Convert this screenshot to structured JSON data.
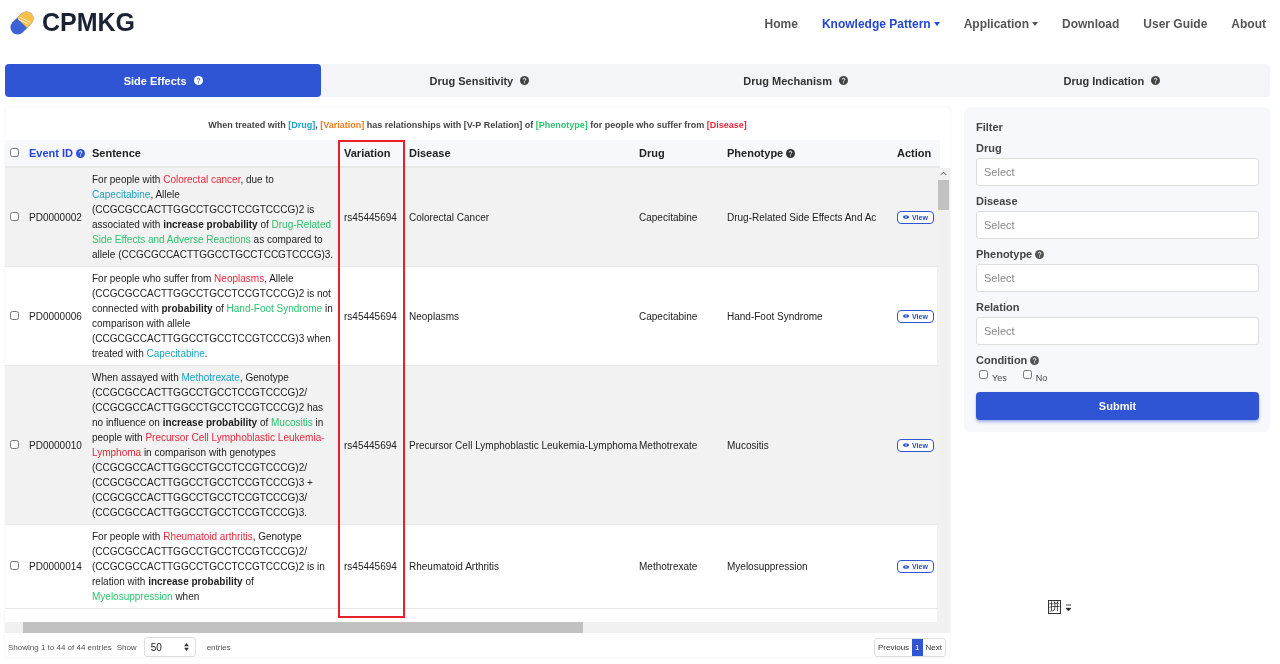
{
  "brand": {
    "name": "CPMKG"
  },
  "nav": [
    {
      "label": "Home",
      "selected": false,
      "dropdown": false
    },
    {
      "label": "Knowledge Pattern",
      "selected": true,
      "dropdown": true
    },
    {
      "label": "Application",
      "selected": false,
      "dropdown": true
    },
    {
      "label": "Download",
      "selected": false,
      "dropdown": false
    },
    {
      "label": "User Guide",
      "selected": false,
      "dropdown": false
    },
    {
      "label": "About",
      "selected": false,
      "dropdown": false
    }
  ],
  "tabs": [
    {
      "label": "Side Effects",
      "selected": true
    },
    {
      "label": "Drug Sensitivity",
      "selected": false
    },
    {
      "label": "Drug Mechanism",
      "selected": false
    },
    {
      "label": "Drug Indication",
      "selected": false
    }
  ],
  "pattern": [
    {
      "text": "When treated with ",
      "kind": "text"
    },
    {
      "text": "[Drug]",
      "kind": "drug"
    },
    {
      "text": ", ",
      "kind": "text"
    },
    {
      "text": "[Variation]",
      "kind": "variation"
    },
    {
      "text": " has relationships with [V-P Relation] of ",
      "kind": "text"
    },
    {
      "text": "[Phenotype]",
      "kind": "phenotype"
    },
    {
      "text": " for people who suffer from ",
      "kind": "text"
    },
    {
      "text": "[Disease]",
      "kind": "disease"
    }
  ],
  "table": {
    "select_all_checked": false,
    "columns": [
      {
        "label": "Event ID",
        "help": true,
        "link": true
      },
      {
        "label": "Sentence",
        "help": false,
        "link": false
      },
      {
        "label": "Variation",
        "help": false,
        "link": false
      },
      {
        "label": "Disease",
        "help": false,
        "link": false
      },
      {
        "label": "Drug",
        "help": false,
        "link": false
      },
      {
        "label": "Phenotype",
        "help": true,
        "link": false
      },
      {
        "label": "Action",
        "help": false,
        "link": false
      }
    ],
    "rows": [
      {
        "checked": false,
        "id": "PD0000002",
        "sentence": [
          {
            "text": "For people with ",
            "kind": "text"
          },
          {
            "text": "Colorectal cancer",
            "kind": "disease"
          },
          {
            "text": ", due to ",
            "kind": "text"
          },
          {
            "text": "Capecitabine",
            "kind": "drug"
          },
          {
            "text": ", Allele (CCGCGCCACTTGGCCTGCCTCCGTCCCG)2 is associated with ",
            "kind": "text"
          },
          {
            "text": "increase probability",
            "kind": "bold"
          },
          {
            "text": " of ",
            "kind": "text"
          },
          {
            "text": "Drug-Related Side Effects and Adverse Reactions",
            "kind": "phenotype"
          },
          {
            "text": " as compared to allele (CCGCGCCACTTGGCCTGCCTCCGTCCCG)3.",
            "kind": "text"
          }
        ],
        "variation": "rs45445694",
        "disease": "Colorectal Cancer",
        "drug": "Capecitabine",
        "phenotype": "Drug-Related Side Effects And Ac",
        "action": "View"
      },
      {
        "checked": false,
        "id": "PD0000006",
        "sentence": [
          {
            "text": "For people who suffer from ",
            "kind": "text"
          },
          {
            "text": "Neoplasms",
            "kind": "disease"
          },
          {
            "text": ", Allele (CCGCGCCACTTGGCCTGCCTCCGTCCCG)2 is not connected with ",
            "kind": "text"
          },
          {
            "text": "probability",
            "kind": "bold"
          },
          {
            "text": " of ",
            "kind": "text"
          },
          {
            "text": "Hand-Foot Syndrome",
            "kind": "phenotype"
          },
          {
            "text": " in comparison with allele (CCGCGCCACTTGGCCTGCCTCCGTCCCG)3 when treated with ",
            "kind": "text"
          },
          {
            "text": "Capecitabine",
            "kind": "drug"
          },
          {
            "text": ".",
            "kind": "text"
          }
        ],
        "variation": "rs45445694",
        "disease": "Neoplasms",
        "drug": "Capecitabine",
        "phenotype": "Hand-Foot Syndrome",
        "action": "View"
      },
      {
        "checked": false,
        "id": "PD0000010",
        "sentence": [
          {
            "text": "When assayed with ",
            "kind": "text"
          },
          {
            "text": "Methotrexate",
            "kind": "drug"
          },
          {
            "text": ", Genotype (CCGCGCCACTTGGCCTGCCTCCGTCCCG)2/ (CCGCGCCACTTGGCCTGCCTCCGTCCCG)2 has no influence on ",
            "kind": "text"
          },
          {
            "text": "increase probability",
            "kind": "bold"
          },
          {
            "text": " of ",
            "kind": "text"
          },
          {
            "text": "Mucositis",
            "kind": "phenotype"
          },
          {
            "text": " in people with ",
            "kind": "text"
          },
          {
            "text": "Precursor Cell Lymphoblastic Leukemia-Lymphoma",
            "kind": "disease"
          },
          {
            "text": " in comparison with genotypes (CCGCGCCACTTGGCCTGCCTCCGTCCCG)2/ (CCGCGCCACTTGGCCTGCCTCCGTCCCG)3 + (CCGCGCCACTTGGCCTGCCTCCGTCCCG)3/ (CCGCGCCACTTGGCCTGCCTCCGTCCCG)3.",
            "kind": "text"
          }
        ],
        "variation": "rs45445694",
        "disease": "Precursor Cell Lymphoblastic Leukemia-Lymphoma",
        "drug": "Methotrexate",
        "phenotype": "Mucositis",
        "action": "View"
      },
      {
        "checked": false,
        "id": "PD0000014",
        "sentence": [
          {
            "text": "For people with ",
            "kind": "text"
          },
          {
            "text": "Rheumatoid arthritis",
            "kind": "disease"
          },
          {
            "text": ", Genotype (CCGCGCCACTTGGCCTGCCTCCGTCCCG)2/ (CCGCGCCACTTGGCCTGCCTCCGTCCCG)2 is in relation with ",
            "kind": "text"
          },
          {
            "text": "increase probability",
            "kind": "bold"
          },
          {
            "text": " of ",
            "kind": "text"
          },
          {
            "text": "Myelosuppression",
            "kind": "phenotype"
          },
          {
            "text": " when",
            "kind": "text"
          }
        ],
        "variation": "rs45445694",
        "disease": "Rheumatoid Arthritis",
        "drug": "Methotrexate",
        "phenotype": "Myelosuppression",
        "action": "View"
      }
    ]
  },
  "footer": {
    "info": "Showing 1 to 44 of 44 entries",
    "show_label": "Show",
    "page_size": "50",
    "entries_label": "entries",
    "pages": [
      {
        "label": "Previous",
        "selected": false
      },
      {
        "label": "1",
        "selected": true
      },
      {
        "label": "Next",
        "selected": false
      }
    ]
  },
  "filter": {
    "title": "Filter",
    "fields": [
      {
        "label": "Drug",
        "help": false,
        "placeholder": "Select"
      },
      {
        "label": "Disease",
        "help": false,
        "placeholder": "Select"
      },
      {
        "label": "Phenotype",
        "help": true,
        "placeholder": "Select"
      },
      {
        "label": "Relation",
        "help": false,
        "placeholder": "Select"
      }
    ],
    "condition": {
      "label": "Condition",
      "help": true,
      "options": [
        {
          "label": "Yes",
          "checked": false
        },
        {
          "label": "No",
          "checked": false
        }
      ]
    },
    "submit": "Submit"
  },
  "ime_indicator": {
    "label": "拼"
  }
}
